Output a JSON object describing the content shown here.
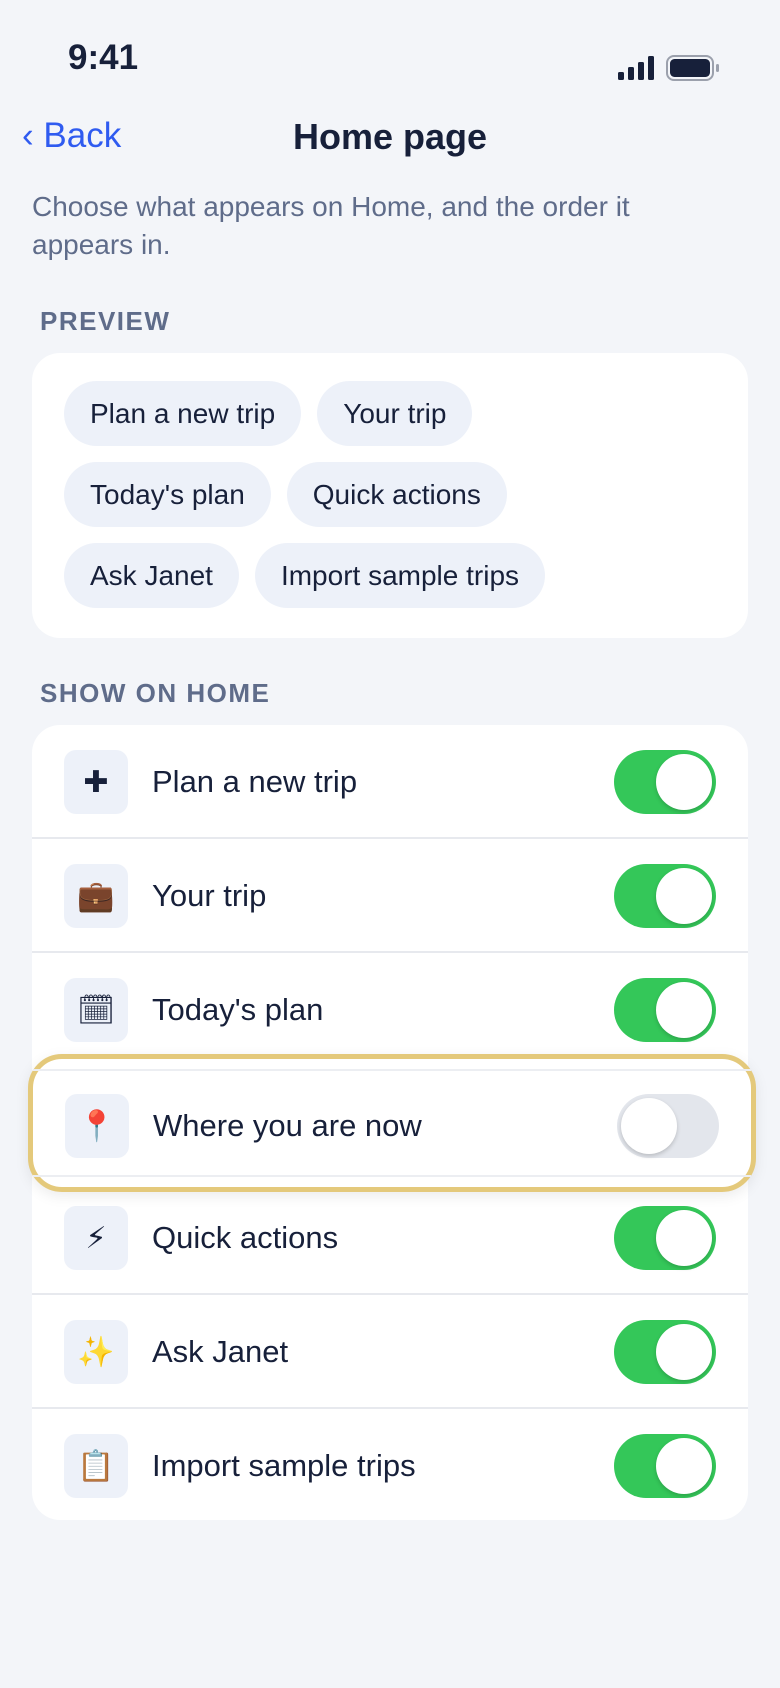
{
  "status_bar": {
    "time": "9:41"
  },
  "nav": {
    "back_label": "‹ Back",
    "title": "Home page"
  },
  "description": "Choose what appears on Home, and the order it appears in.",
  "preview": {
    "section_label": "PREVIEW",
    "chips": [
      "Plan a new trip",
      "Your trip",
      "Today's plan",
      "Quick actions",
      "Ask Janet",
      "Import sample trips"
    ]
  },
  "show_on_home": {
    "section_label": "SHOW ON HOME",
    "items": [
      {
        "label": "Plan a new trip",
        "icon": "plus-icon",
        "glyph": "✚",
        "enabled": true
      },
      {
        "label": "Your trip",
        "icon": "suitcase-icon",
        "glyph": "💼",
        "enabled": true
      },
      {
        "label": "Today's plan",
        "icon": "calendar-icon",
        "glyph": "🗓",
        "enabled": true
      },
      {
        "label": "Where you are now",
        "icon": "pin-icon",
        "glyph": "📍",
        "enabled": false
      },
      {
        "label": "Quick actions",
        "icon": "lightning-icon",
        "glyph": "⚡",
        "enabled": true
      },
      {
        "label": "Ask Janet",
        "icon": "sparkles-icon",
        "glyph": "✨",
        "enabled": true
      },
      {
        "label": "Import sample trips",
        "icon": "clipboard-icon",
        "glyph": "📋",
        "enabled": true
      }
    ]
  },
  "colors": {
    "accent": "#2f5bf0",
    "toggle_on": "#34c759",
    "highlight_border": "#e4c97b"
  }
}
